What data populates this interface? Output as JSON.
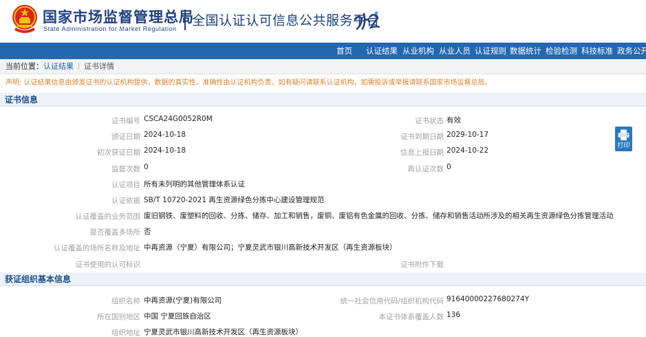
{
  "header": {
    "org_cn": "国家市场监督管理总局",
    "org_en": "State Administration  for  Market Regulation",
    "platform": "全国认证认可信息公共服务平台"
  },
  "nav": [
    "首页",
    "认证结果",
    "从业机构",
    "从业人员",
    "认证规则",
    "数据统计",
    "检验检测",
    "科技标准",
    "政务公开"
  ],
  "breadcrumb": {
    "prefix": "当前位置：",
    "link": "认证结果",
    "current": "证书详情"
  },
  "notice": "声明: 认证结果信息由颁发证书的认证机构提供，数据的真实性、准确性由认证机构负责，如有疑问请联系认证机构，如需投诉或举报请联系国家市场监督总局。",
  "print_label": "打印",
  "cert_section": {
    "title": "证书信息",
    "rows": [
      {
        "label": "证书编号",
        "value": "CSCA24G0052R0M",
        "label2": "证书状态",
        "value2": "有效"
      },
      {
        "label": "颁证日期",
        "value": "2024-10-18",
        "label2": "证书到期日期",
        "value2": "2029-10-17"
      },
      {
        "label": "初次获证日期",
        "value": "2024-10-18",
        "label2": "信息上报日期",
        "value2": "2024-10-22"
      },
      {
        "label": "监督次数",
        "value": "0",
        "label2": "再认证次数",
        "value2": "0"
      },
      {
        "label": "认证项目",
        "value": "所有未列明的其他管理体系认证",
        "label2": "",
        "value2": ""
      },
      {
        "label": "认证依据",
        "value": "SB/T 10720-2021 再生资源绿色分拣中心建设管理规范",
        "label2": "",
        "value2": ""
      },
      {
        "label": "认证覆盖的业务范围",
        "value": "废旧钢铁、废塑料的回收、分拣、储存、加工和销售，废铜、废铝有色金属的回收、分拣、储存和销售活动所涉及的相关再生资源绿色分拣管理活动",
        "label2": "",
        "value2": ""
      },
      {
        "label": "是否覆盖多场所",
        "value": "否",
        "label2": "",
        "value2": ""
      },
      {
        "label": "认证覆盖的场所名称及地址",
        "value": "中再资源（宁夏）有限公司；宁夏灵武市银川高新技术开发区（再生资源板块）",
        "label2": "",
        "value2": ""
      },
      {
        "label": "证书使用的认可标识",
        "value": "",
        "label2": "证书附件下载",
        "value2": ""
      }
    ]
  },
  "org_section": {
    "title": "获证组织基本信息",
    "rows": [
      {
        "label": "组织名称",
        "value": "中再资源(宁夏)有限公司",
        "label2": "统一社会信用代码/组织机构代码",
        "value2": "91640000227680274Y"
      },
      {
        "label": "所在国别地区",
        "value": "中国  宁夏回族自治区",
        "label2": "本证书体系覆盖人数",
        "value2": "136"
      },
      {
        "label": "组织地址",
        "value": "宁夏灵武市银川高新技术开发区（再生资源板块）",
        "label2": "",
        "value2": ""
      }
    ]
  }
}
